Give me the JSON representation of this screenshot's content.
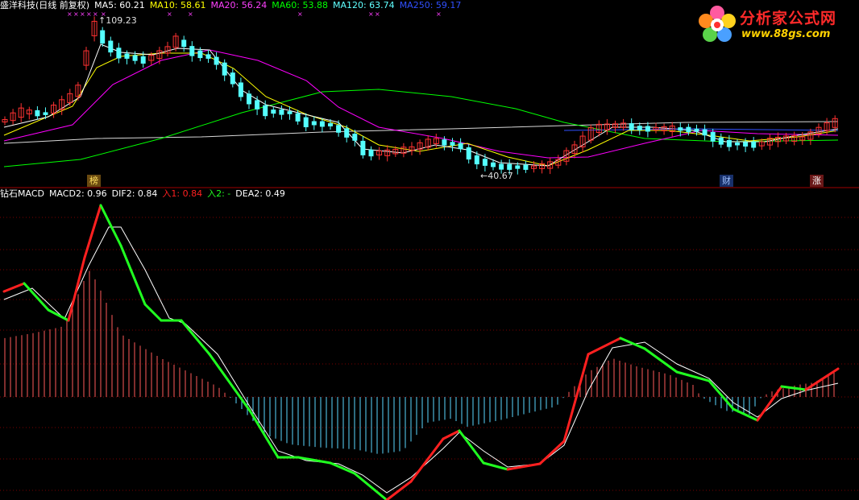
{
  "price_header": {
    "title": "盛洋科技(日线 前复权)",
    "ma5": "MA5: 60.21",
    "ma10": "MA10: 58.61",
    "ma20": "MA20: 56.24",
    "ma60": "MA60: 53.88",
    "ma120": "MA120: 63.74",
    "ma250": "MA250: 59.17"
  },
  "macd_header": {
    "title": "钻石MACD",
    "macd2": "MACD2: 0.96",
    "dif2": "DIF2: 0.84",
    "in1": "入1: 0.84",
    "in2": "入2: -",
    "dea2": "DEA2: 0.49"
  },
  "logo": {
    "name": "分析家公式网",
    "url": "www.88gs.com"
  },
  "markers": {
    "bang": "榜",
    "cai": "财",
    "zhang": "涨"
  },
  "annotations": {
    "high": "109.23",
    "low": "←40.67"
  },
  "colors": {
    "ma5": "#ffffff",
    "ma10": "#ffff00",
    "ma20": "#ff00ff",
    "ma60": "#00ff00",
    "ma120": "#40ffff",
    "ma250": "#3050ff",
    "up": "#ff3232",
    "down": "#54ffff",
    "dif": "#ff2020",
    "dif_fall": "#20ff20",
    "dea": "#ffffff"
  },
  "chart_data": {
    "type": "candlestick+macd",
    "price_range": [
      40.67,
      109.23
    ],
    "high": 109.23,
    "low": 40.67,
    "ma_last": {
      "MA5": 60.21,
      "MA10": 58.61,
      "MA20": 56.24,
      "MA60": 53.88,
      "MA120": 63.74,
      "MA250": 59.17
    },
    "macd_last": {
      "MACD2": 0.96,
      "DIF2": 0.84,
      "DEA2": 0.49
    }
  }
}
